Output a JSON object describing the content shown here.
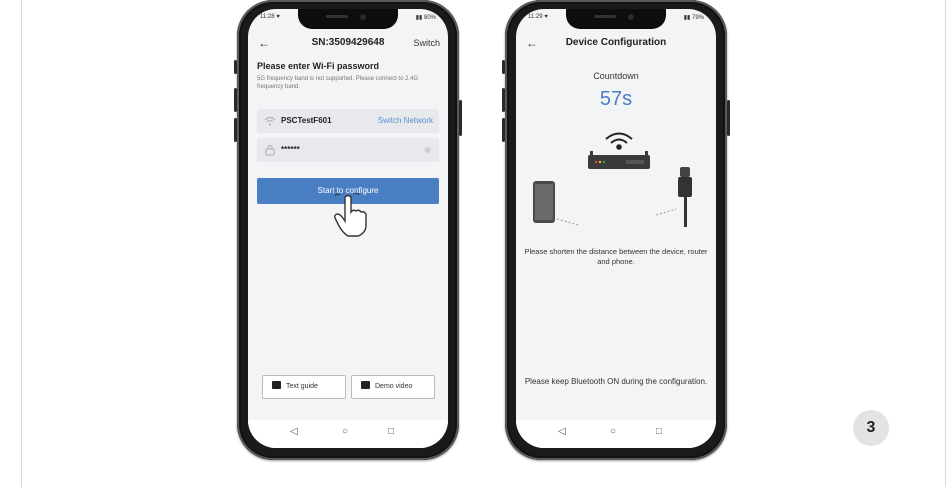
{
  "left_phone": {
    "status_time": "11:28 ♥",
    "status_battery": "▮▮ 80%",
    "title": "SN:3509429648",
    "switch_label": "Switch",
    "heading": "Please enter Wi-Fi password",
    "note": "5G frequency band is not supported. Please connect to 2.4G frequency band.",
    "network_name": "PSCTestF601",
    "switch_network_label": "Switch Network",
    "password_value": "******",
    "cta_label": "Start to configure",
    "text_guide_label": "Text guide",
    "demo_video_label": "Demo video"
  },
  "right_phone": {
    "status_time": "11:29 ♥",
    "status_battery": "▮▮ 79%",
    "title": "Device Configuration",
    "countdown_label": "Countdown",
    "countdown_value": "57s",
    "hint_distance": "Please shorten the distance between the device, router and phone.",
    "hint_bluetooth": "Please keep Bluetooth ON during the configuration."
  },
  "nav": {
    "back": "◁",
    "home": "○",
    "recent": "□"
  },
  "step_number": "3",
  "colors": {
    "accent": "#4a7ec2",
    "background": "#f3f4f6"
  }
}
